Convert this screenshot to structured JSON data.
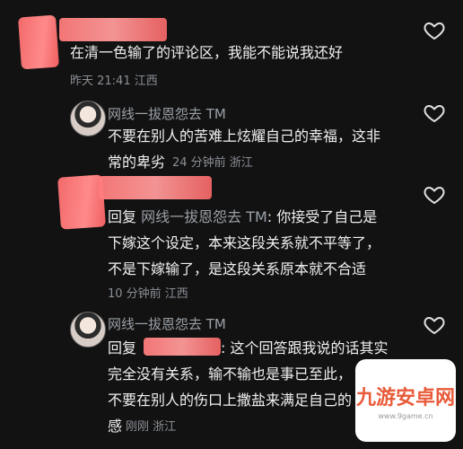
{
  "comments": [
    {
      "text": "在清一色输了的评论区，我能不能说我还好",
      "meta": "昨天 21:41 江西"
    },
    {
      "username": "网线一拔恩怨去 TM",
      "lines": [
        "不要在别人的苦难上炫耀自己的幸福，这非",
        "常的卑劣"
      ],
      "meta": "24 分钟前 浙江"
    },
    {
      "reply_prefix": "回复",
      "reply_name": "网线一拔恩怨去 TM",
      "lines": [
        ": 你接受了自己是",
        "下嫁这个设定，本来这段关系就不平等了，",
        "不是下嫁输了，是这段关系原本就不合适"
      ],
      "meta": "10 分钟前 江西"
    },
    {
      "username": "网线一拔恩怨去 TM",
      "reply_prefix": "回复",
      "lines": [
        ": 这个回答跟我说的话其实",
        "完全没有关系，输不输也是事已至此，",
        "不要在别人的伤口上撒盐来满足自己的",
        "感"
      ],
      "meta": "刚刚 浙江"
    }
  ],
  "watermark": {
    "text": "九游安卓网",
    "sub": "www.9game.cn"
  },
  "colors": {
    "background": "#121212",
    "redaction": "#ff8080",
    "meta": "#8a8f95"
  },
  "icons": {
    "like": "heart-outline-icon"
  }
}
